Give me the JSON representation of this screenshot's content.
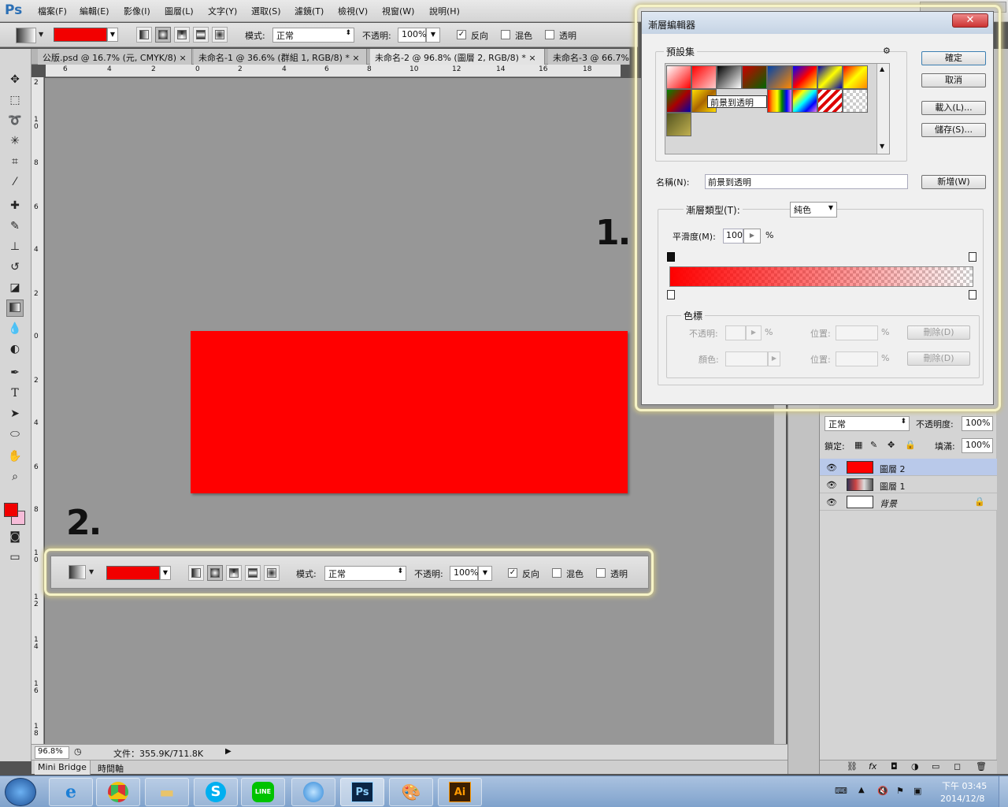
{
  "app": {
    "logo": "Ps"
  },
  "menu": [
    "檔案(F)",
    "編輯(E)",
    "影像(I)",
    "圖層(L)",
    "文字(Y)",
    "選取(S)",
    "濾鏡(T)",
    "檢視(V)",
    "視窗(W)",
    "說明(H)"
  ],
  "options": {
    "mode_label": "模式:",
    "mode_value": "正常",
    "opacity_label": "不透明:",
    "opacity_value": "100%",
    "reverse_label": "反向",
    "dither_label": "混色",
    "transparency_label": "透明",
    "reverse_checked": "✓"
  },
  "tabs": [
    "公版.psd @ 16.7% (元, CMYK/8)",
    "未命名-1 @ 36.6% (群組 1, RGB/8) *",
    "未命名-2 @ 96.8% (圖層 2, RGB/8) *",
    "未命名-3 @ 66.7%"
  ],
  "ruler": {
    "h": [
      "6",
      "4",
      "2",
      "0",
      "2",
      "4",
      "6",
      "8",
      "10",
      "12",
      "14",
      "16",
      "18"
    ],
    "v": [
      "2",
      "10",
      "8",
      "6",
      "4",
      "2",
      "0",
      "2",
      "4",
      "6",
      "8",
      "10",
      "12",
      "14",
      "16",
      "18"
    ]
  },
  "annotations": {
    "one": "1.",
    "two": "2."
  },
  "status": {
    "zoom": "96.8%",
    "doc": "文件：355.9K/711.8K"
  },
  "bottom_tabs": {
    "mini_bridge": "Mini Bridge",
    "timeline": "時間軸"
  },
  "layers": {
    "blend_mode": "正常",
    "opacity_label": "不透明度:",
    "opacity": "100%",
    "lock_label": "鎖定:",
    "fill_label": "填滿:",
    "fill": "100%",
    "items": [
      {
        "name": "圖層 2",
        "active": true
      },
      {
        "name": "圖層 1",
        "active": false
      },
      {
        "name": "背景",
        "active": false
      }
    ]
  },
  "dialog": {
    "title": "漸層編輯器",
    "presets_label": "預設集",
    "tooltip": "前景到透明",
    "ok": "確定",
    "cancel": "取消",
    "load": "載入(L)...",
    "save": "儲存(S)...",
    "name_label": "名稱(N):",
    "name_value": "前景到透明",
    "new": "新增(W)",
    "type_label": "漸層類型(T):",
    "type_value": "純色",
    "smooth_label": "平滑度(M):",
    "smooth_value": "100",
    "percent": "%",
    "stops_label": "色標",
    "opacity_label": "不透明:",
    "color_label": "顏色:",
    "location_label": "位置:",
    "delete": "刪除(D)"
  },
  "colors": {
    "accent": "#ff0000",
    "selection": "#b9c9ea"
  },
  "taskbar": {
    "ps": "Ps",
    "ai": "Ai",
    "line": "LINE",
    "time": "下午 03:45",
    "date": "2014/12/8"
  }
}
